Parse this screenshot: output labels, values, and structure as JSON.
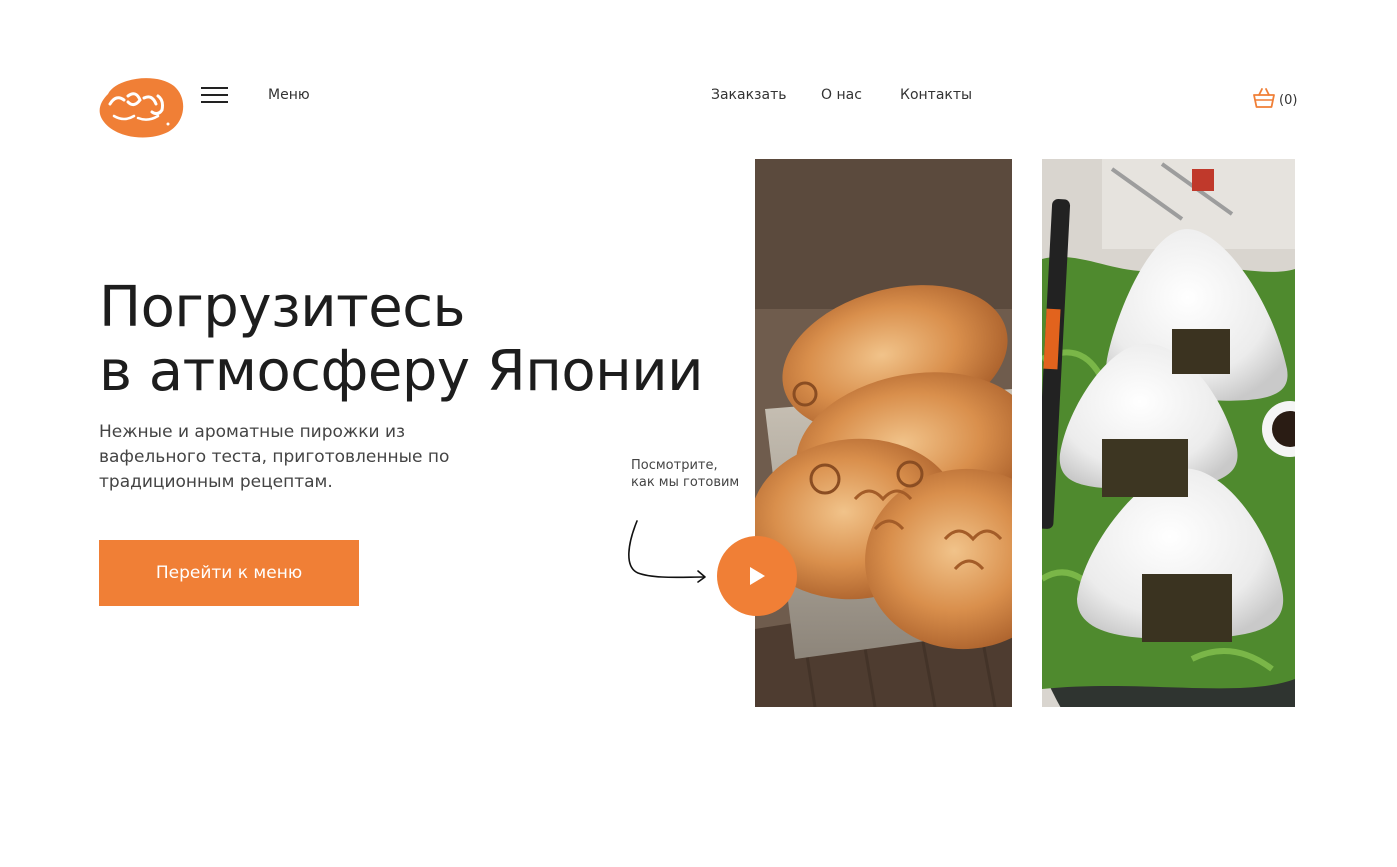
{
  "header": {
    "logo_text": "тайяки",
    "menu_label": "Меню",
    "nav": {
      "order": "Закакзать",
      "about": "О нас",
      "contacts": "Контакты"
    },
    "cart_count": "(0)"
  },
  "hero": {
    "title_line1": "Погрузитесь",
    "title_line2": "в атмосферу Японии",
    "subtitle": "Нежные и ароматные пирожки из вафельного теста, приготовленные по традиционным рецептам.",
    "cta_label": "Перейти к меню",
    "watch_text_line1": "Посмотрите,",
    "watch_text_line2": "как мы готовим"
  },
  "colors": {
    "accent": "#f07f36",
    "text": "#1d1d1d",
    "background": "#ffffff"
  },
  "icons": {
    "burger": "hamburger-menu-icon",
    "cart": "basket-icon",
    "play": "play-icon",
    "arrow": "curved-arrow-icon"
  }
}
